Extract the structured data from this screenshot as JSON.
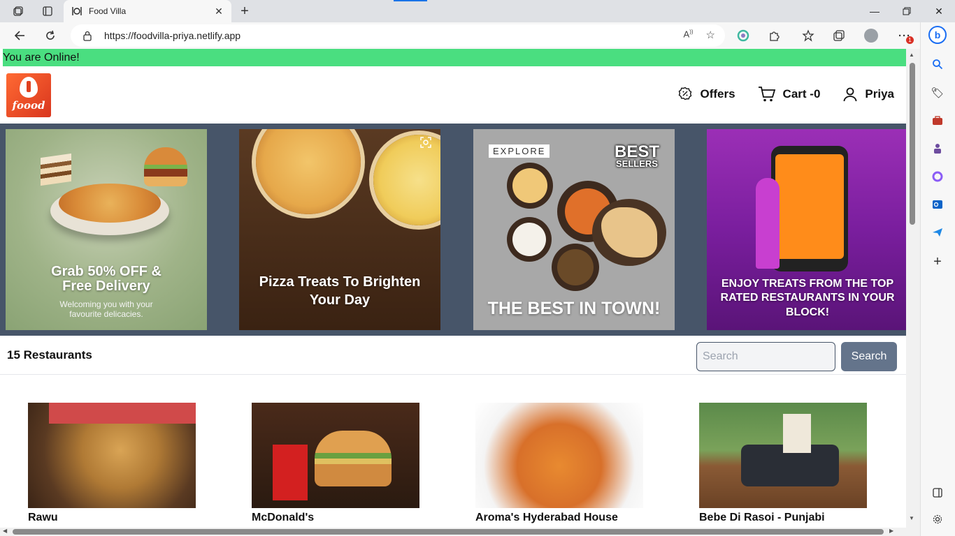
{
  "browser": {
    "tab_title": "Food Villa",
    "url": "https://foodvilla-priya.netlify.app",
    "notification_count": "1"
  },
  "page": {
    "online_status": "You are Online!",
    "logo_text": "foood",
    "nav": {
      "offers": "Offers",
      "cart": "Cart -0",
      "user": "Priya"
    },
    "banners": [
      {
        "title": "Grab 50% OFF & Free Delivery",
        "subtitle": "Welcoming you with your favourite delicacies."
      },
      {
        "title": "Pizza Treats To Brighten Your Day"
      },
      {
        "tag": "EXPLORE",
        "badge_top": "BEST",
        "badge_bottom": "SELLERS",
        "title": "THE BEST IN TOWN!"
      },
      {
        "title": "ENJOY TREATS FROM THE TOP RATED RESTAURANTS IN YOUR BLOCK!"
      }
    ],
    "restaurant_count": "15 Restaurants",
    "search": {
      "placeholder": "Search",
      "button": "Search"
    },
    "restaurants": [
      {
        "name": "Rawu"
      },
      {
        "name": "McDonald's"
      },
      {
        "name": "Aroma's Hyderabad House"
      },
      {
        "name": "Bebe Di Rasoi - Punjabi"
      }
    ]
  },
  "colors": {
    "online_bar": "#4ade80",
    "banner_strip": "#475569",
    "search_button": "#64748b",
    "logo": "#e84a25"
  }
}
